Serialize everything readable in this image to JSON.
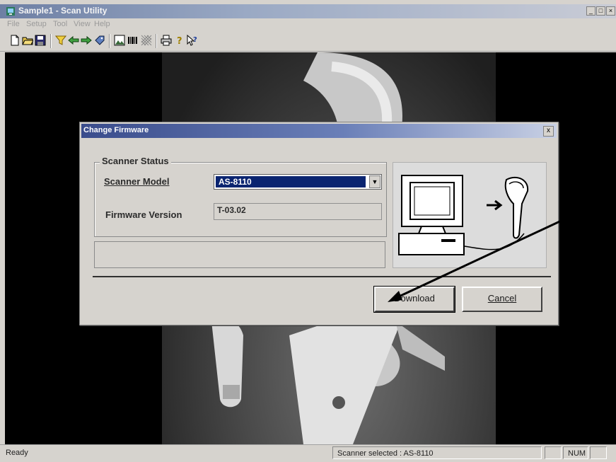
{
  "window": {
    "title": "Sample1 - Scan Utility",
    "controls": [
      "_",
      "□",
      "×"
    ]
  },
  "menu": {
    "items": [
      "File",
      "Setup",
      "Tool",
      "View",
      "Help"
    ]
  },
  "toolbar": {
    "icons": [
      "new-file-icon",
      "open-folder-icon",
      "save-icon",
      "filter-icon",
      "send-icon",
      "receive-icon",
      "tag-icon",
      "image-icon",
      "barcode-icon",
      "grid-icon",
      "print-icon",
      "help-icon",
      "context-help-icon"
    ]
  },
  "status": {
    "left": "Ready",
    "scanner": "Scanner selected : AS-8110",
    "num": "NUM"
  },
  "dialog": {
    "title": "Change Firmware",
    "close": "x",
    "group_title": "Scanner Status",
    "model_label": "Scanner Model",
    "model_value": "AS-8110",
    "fw_label": "Firmware Version",
    "fw_value": "T-03.02",
    "download": "Download",
    "cancel": "Cancel"
  }
}
